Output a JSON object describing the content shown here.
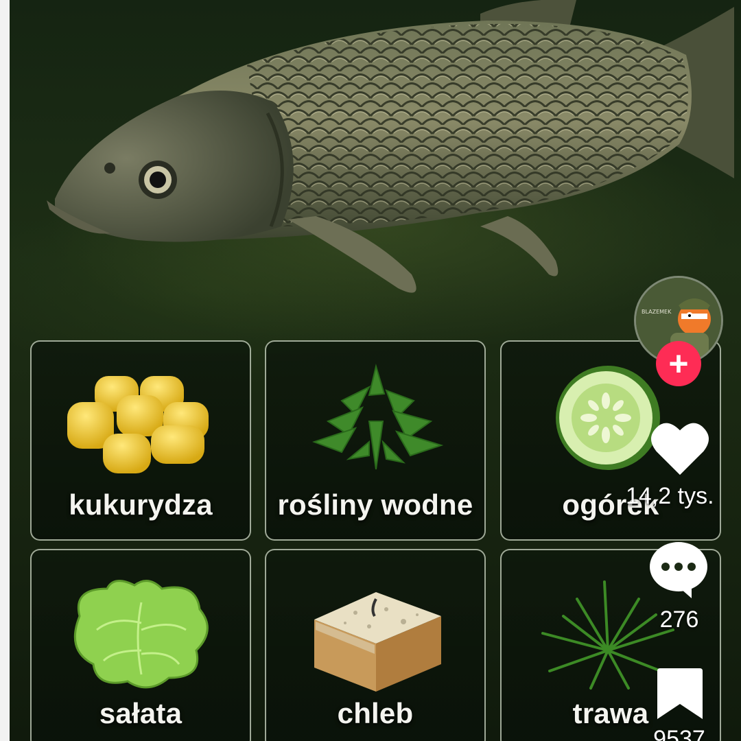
{
  "foods": [
    {
      "id": "corn",
      "label": "kukurydza",
      "icon": "corn-icon"
    },
    {
      "id": "water-plants",
      "label": "rośliny wodne",
      "icon": "water-plant-icon"
    },
    {
      "id": "cucumber",
      "label": "ogórek",
      "icon": "cucumber-icon"
    },
    {
      "id": "lettuce",
      "label": "sałata",
      "icon": "lettuce-icon"
    },
    {
      "id": "bread",
      "label": "chleb",
      "icon": "bread-icon"
    },
    {
      "id": "grass",
      "label": "trawa",
      "icon": "grass-icon"
    }
  ],
  "sidebar": {
    "follow_label": "+",
    "likes": "14,2 tys.",
    "comments": "276",
    "saves": "9537"
  },
  "colors": {
    "accent": "#fe2c55",
    "card_border": "#d2dcc8"
  }
}
